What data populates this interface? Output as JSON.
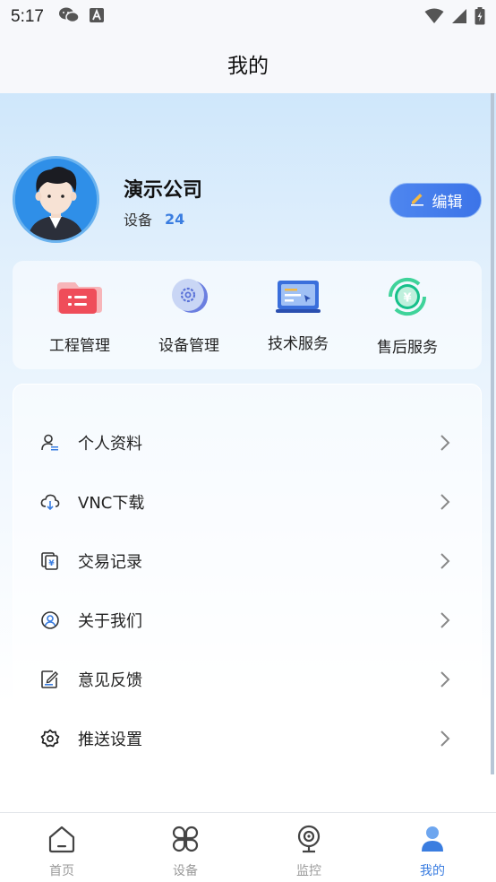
{
  "status_bar": {
    "time": "5:17",
    "icons": [
      "wechat-icon",
      "a-icon"
    ],
    "system_icons": [
      "wifi-icon",
      "signal-icon",
      "battery-icon"
    ]
  },
  "header": {
    "title": "我的"
  },
  "profile": {
    "company": "演示公司",
    "device_label": "设备",
    "device_count": "24",
    "edit_label": "编辑"
  },
  "quick_actions": [
    {
      "label": "工程管理",
      "icon": "project-folder-icon"
    },
    {
      "label": "设备管理",
      "icon": "device-gear-icon"
    },
    {
      "label": "技术服务",
      "icon": "tech-service-icon"
    },
    {
      "label": "售后服务",
      "icon": "after-sales-yuan-icon"
    }
  ],
  "menu": [
    {
      "label": "个人资料",
      "icon": "user-profile-icon"
    },
    {
      "label": "VNC下载",
      "icon": "cloud-download-icon"
    },
    {
      "label": "交易记录",
      "icon": "transaction-record-icon"
    },
    {
      "label": "关于我们",
      "icon": "about-user-circle-icon"
    },
    {
      "label": "意见反馈",
      "icon": "feedback-edit-icon"
    },
    {
      "label": "推送设置",
      "icon": "settings-gear-icon"
    }
  ],
  "tabs": [
    {
      "label": "首页",
      "icon": "home-icon",
      "active": false
    },
    {
      "label": "设备",
      "icon": "devices-grid-icon",
      "active": false
    },
    {
      "label": "监控",
      "icon": "camera-icon",
      "active": false
    },
    {
      "label": "我的",
      "icon": "person-icon",
      "active": true
    }
  ],
  "colors": {
    "accent": "#3a7de0",
    "tab_inactive": "#9a9a9a",
    "hero_top": "#cfe7fb"
  }
}
